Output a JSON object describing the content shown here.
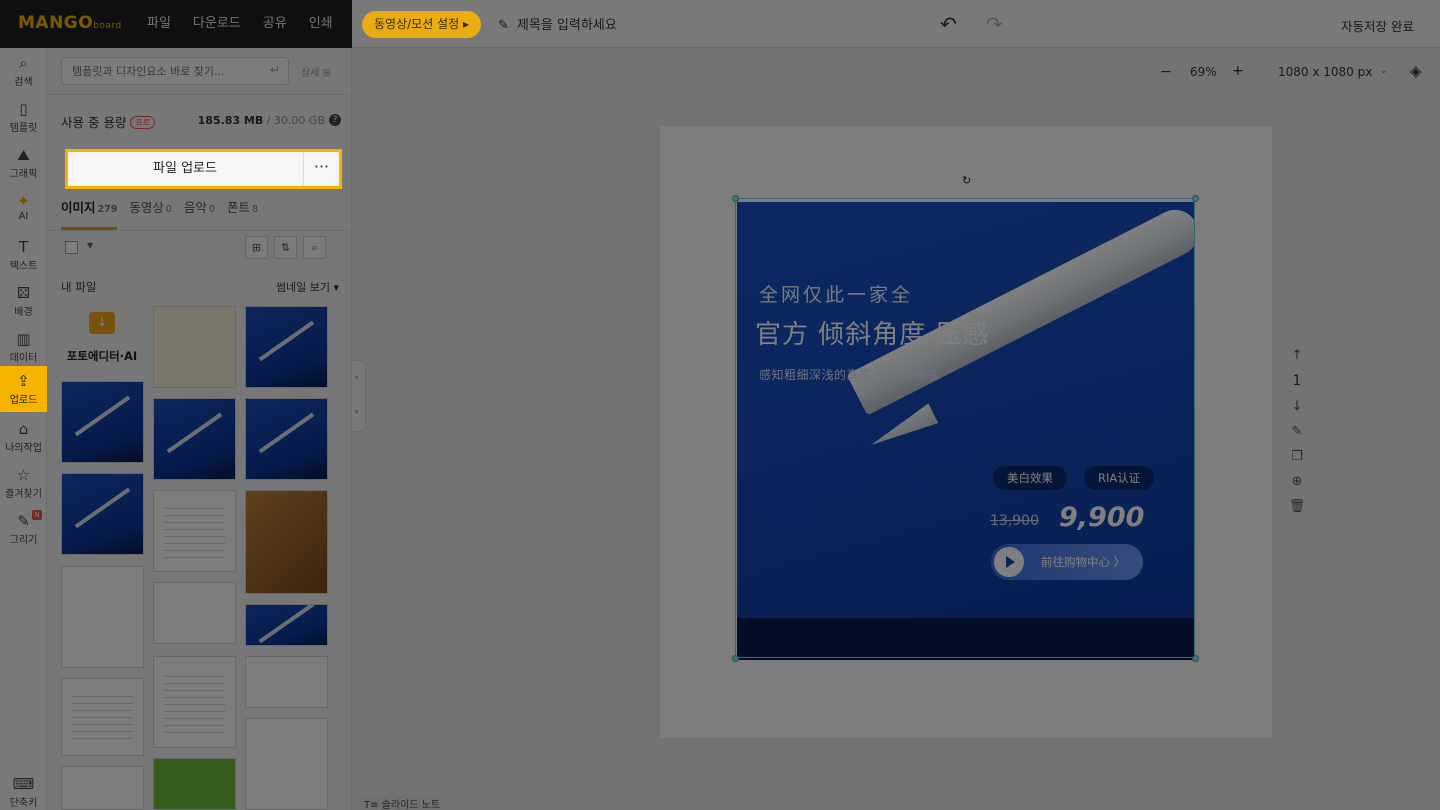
{
  "app": {
    "logo": "MANGO",
    "logo_suffix": "board",
    "menu": [
      "파일",
      "다운로드",
      "공유",
      "인쇄"
    ],
    "video_button": "동영상/모션 설정 ▸",
    "title_placeholder": "제목을 입력하세요",
    "autosave": "자동저장 완료"
  },
  "rail": {
    "items": [
      {
        "icon": "search-icon",
        "glyph": "⌕",
        "label": "검색"
      },
      {
        "icon": "template-icon",
        "glyph": "▯",
        "label": "템플릿"
      },
      {
        "icon": "graphic-icon",
        "glyph": "⛰",
        "label": "그래픽"
      },
      {
        "icon": "ai-icon",
        "glyph": "✦",
        "label": "AI"
      },
      {
        "icon": "text-icon",
        "glyph": "T",
        "label": "텍스트"
      },
      {
        "icon": "background-icon",
        "glyph": "⚄",
        "label": "배경"
      },
      {
        "icon": "data-icon",
        "glyph": "▥",
        "label": "데이터"
      },
      {
        "icon": "upload-icon",
        "glyph": "⇪",
        "label": "업로드"
      },
      {
        "icon": "my-work-icon",
        "glyph": "⌂",
        "label": "나의작업"
      },
      {
        "icon": "favorites-icon",
        "glyph": "☆",
        "label": "즐겨찾기"
      },
      {
        "icon": "draw-icon",
        "glyph": "✎",
        "label": "그리기"
      }
    ],
    "draw_badge": "N",
    "shortcut_label": "단축키"
  },
  "panel": {
    "search_placeholder": "템플릿과 디자인요소 바로 찾기...",
    "search_enter": "↵",
    "detail_label": "상세",
    "usage_label": "사용 중 용량",
    "usage_badge": "프로",
    "usage_value": "185.83 MB",
    "usage_total": " / 30.00 GB",
    "upload_button": "파일 업로드",
    "upload_more": "···",
    "tabs": [
      {
        "label": "이미지",
        "count": "279"
      },
      {
        "label": "동영상",
        "count": "0"
      },
      {
        "label": "음악",
        "count": "0"
      },
      {
        "label": "폰트",
        "count": "8"
      }
    ],
    "my_files": "내 파일",
    "view_mode": "썸네일 보기 ▾",
    "photo_editor_label": "포토에디터·AI"
  },
  "workspace": {
    "zoom_value": "69%",
    "zoom_minus": "−",
    "zoom_plus": "+",
    "canvas_size": "1080 x 1080 px",
    "page_number": "1",
    "slide_note": "슬라이드 노트"
  },
  "design": {
    "line1": "全网仅此一家全",
    "line2": "官方 倾斜角度 压感",
    "line3": "感知粗细深浅的真实 书写绘画感",
    "pill1": "美白效果",
    "pill2": "RIA认证",
    "old_price": "13,900",
    "new_price": "9,900",
    "cta": "前往购物中心 〉"
  }
}
